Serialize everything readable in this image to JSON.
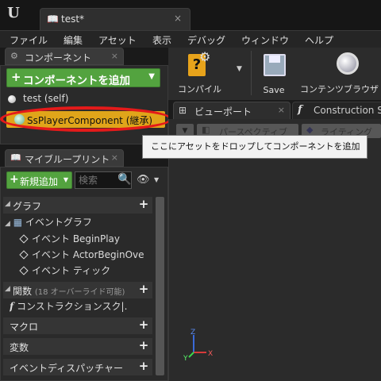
{
  "window": {
    "logo": "U",
    "tab_title": "test*",
    "tab_close": "×"
  },
  "menu": [
    "ファイル",
    "編集",
    "アセット",
    "表示",
    "デバッグ",
    "ウィンドウ",
    "ヘルプ"
  ],
  "components_panel": {
    "title": "コンポーネント",
    "add_button": "コンポーネントを追加",
    "items": [
      {
        "label": "test (self)"
      },
      {
        "label": "SsPlayerComponent (継承)"
      }
    ]
  },
  "blueprint_panel": {
    "title": "マイブループリント",
    "new_add": "新規追加",
    "search_placeholder": "検索",
    "graph_section": "グラフ",
    "event_graph": "イベントグラフ",
    "events": [
      "イベント BeginPlay",
      "イベント ActorBeginOve",
      "イベント ティック"
    ],
    "functions_section": "関数",
    "functions_count": "(18 オーバーライド可能)",
    "construction_script": "コンストラクションスク|.",
    "macros_section": "マクロ",
    "variables_section": "変数",
    "dispatchers_section": "イベントディスパッチャー"
  },
  "toolbar": {
    "compile": "コンパイル",
    "save": "Save",
    "content_browser": "コンテンツブラウザ"
  },
  "editor_tabs": {
    "viewport": "ビューポート",
    "construction": "Construction Sc"
  },
  "viewport": {
    "perspective": "パースペクティブ",
    "lighting": "ライティング"
  },
  "tooltip": "ここにアセットをドロップしてコンポーネントを追加",
  "gizmo": {
    "x": "X",
    "y": "Y",
    "z": "Z"
  },
  "colors": {
    "accent_green": "#53a33f",
    "selected_orange": "#e0a51a",
    "highlight_red": "#e41a1a"
  }
}
